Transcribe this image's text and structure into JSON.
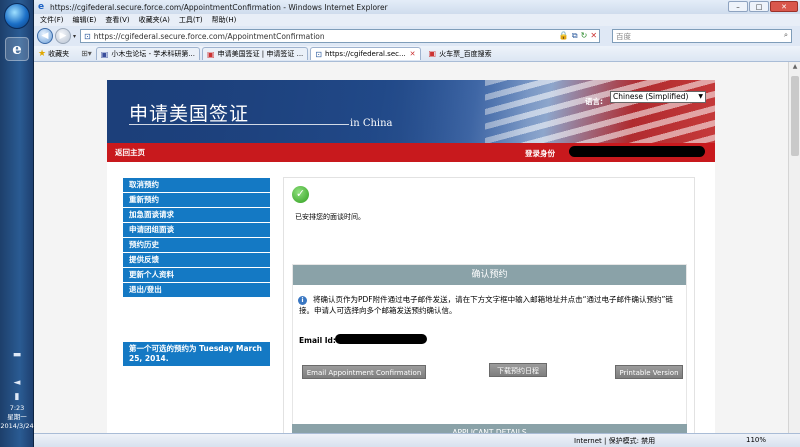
{
  "browser": {
    "title": "https://cgifederal.secure.force.com/AppointmentConfirmation - Windows Internet Explorer",
    "menu": [
      "文件(F)",
      "编辑(E)",
      "查看(V)",
      "收藏夹(A)",
      "工具(T)",
      "帮助(H)"
    ],
    "address": "https://cgifederal.secure.force.com/AppointmentConfirmation",
    "search_placeholder": "百度",
    "favorites_label": "收藏夹",
    "tabs": [
      {
        "label": "小木虫论坛 - 学术科研第...",
        "active": false
      },
      {
        "label": "申请美国签证 | 申请签证 ...",
        "active": false
      },
      {
        "label": "https://cgifederal.sec...",
        "active": true
      }
    ],
    "extra_link": "火车票_百度搜索",
    "status_zone": "Internet | 保护模式: 禁用",
    "zoom": "110%"
  },
  "taskbar": {
    "time": "7:23",
    "weekday": "星期一",
    "date": "2014/3/24"
  },
  "site": {
    "title": "申请美国签证",
    "subtitle": "in China",
    "language_label": "语言:",
    "language_value": "Chinese (Simplified)",
    "home_link": "返回主页",
    "login_label": "登录身份",
    "nav": [
      "取消预约",
      "重新预约",
      "加急面谈请求",
      "申请团组面谈",
      "预约历史",
      "提供反馈",
      "更新个人资料",
      "退出/登出"
    ],
    "first_available": "第一个可选的预约为  Tuesday March 25, 2014.",
    "scheduled_text": "已安排您的面谈时间。",
    "confirm_header": "确认预约",
    "info_text": "将确认页作为PDF附件通过电子邮件发送，请在下方文字框中输入邮箱地址并点击“通过电子邮件确认预约”链接。申请人可选择向多个邮箱发送预约确认信。",
    "email_label": "Email Id:",
    "buttons": {
      "email": "Email Appointment Confirmation",
      "download": "下载预约日程",
      "print": "Printable Version"
    },
    "applicant_details": "APPLICANT DETAILS"
  }
}
